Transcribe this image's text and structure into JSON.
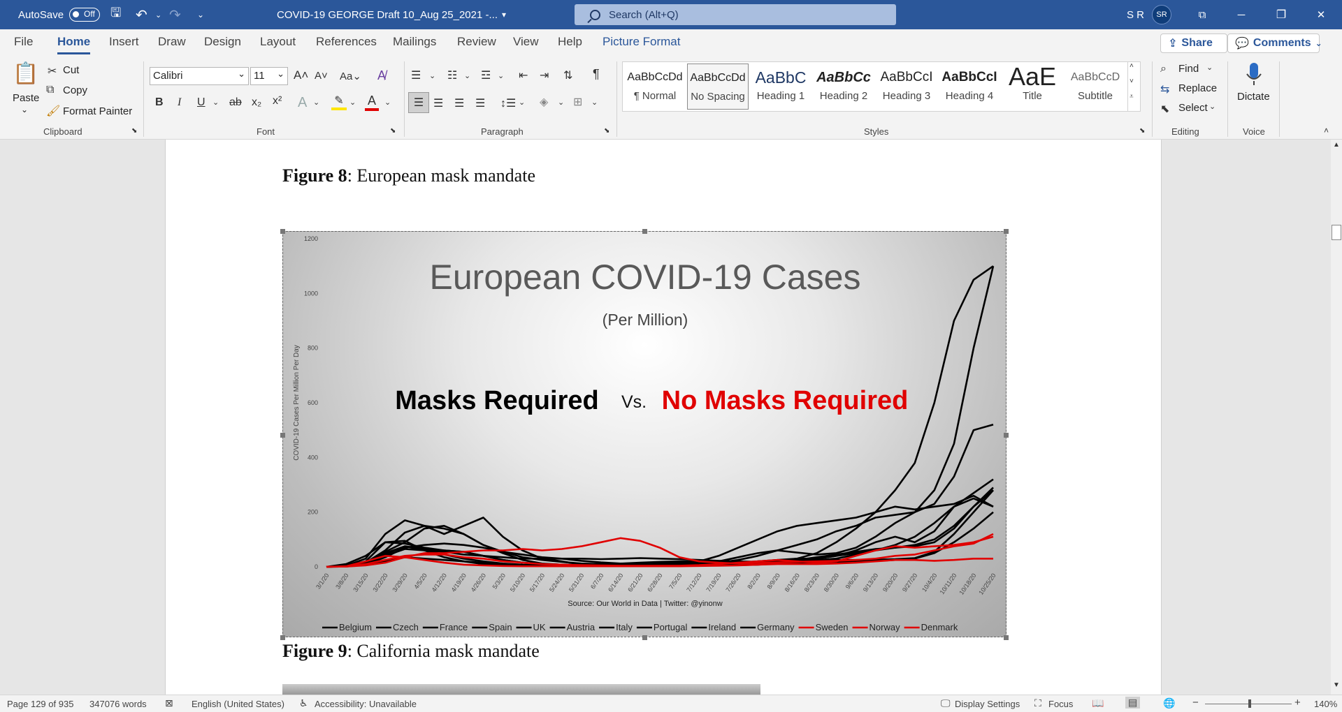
{
  "titlebar": {
    "autosave_label": "AutoSave",
    "autosave_state": "Off",
    "doc_title": "COVID-19 GEORGE Draft 10_Aug 25_2021  -...",
    "search_placeholder": "Search (Alt+Q)",
    "user_initials": "S R",
    "avatar_initials": "SR"
  },
  "tabs": [
    "File",
    "Home",
    "Insert",
    "Draw",
    "Design",
    "Layout",
    "References",
    "Mailings",
    "Review",
    "View",
    "Help",
    "Picture Format"
  ],
  "tabs_right": {
    "share": "Share",
    "comments": "Comments"
  },
  "clipboard": {
    "paste": "Paste",
    "cut": "Cut",
    "copy": "Copy",
    "format_painter": "Format Painter",
    "group": "Clipboard"
  },
  "font": {
    "name": "Calibri",
    "size": "11",
    "group": "Font"
  },
  "paragraph": {
    "group": "Paragraph"
  },
  "styles": {
    "group": "Styles",
    "items": [
      {
        "preview": "AaBbCcDd",
        "name": "¶ Normal"
      },
      {
        "preview": "AaBbCcDd",
        "name": "No Spacing"
      },
      {
        "preview": "AaBbC",
        "name": "Heading 1"
      },
      {
        "preview": "AaBbCc",
        "name": "Heading 2"
      },
      {
        "preview": "AaBbCcI",
        "name": "Heading 3"
      },
      {
        "preview": "AaBbCcI",
        "name": "Heading 4"
      },
      {
        "preview": "AaE",
        "name": "Title"
      },
      {
        "preview": "AaBbCcD",
        "name": "Subtitle"
      }
    ]
  },
  "editing": {
    "find": "Find",
    "replace": "Replace",
    "select": "Select",
    "group": "Editing"
  },
  "voice": {
    "dictate": "Dictate",
    "group": "Voice"
  },
  "document": {
    "caption8_bold": "Figure 8",
    "caption8_rest": ": European mask mandate",
    "caption9_bold": "Figure 9",
    "caption9_rest": ": California mask mandate"
  },
  "chart_data": {
    "type": "line",
    "title": "European COVID-19 Cases",
    "subtitle": "(Per Million)",
    "annotation_left": "Masks Required",
    "annotation_vs": "Vs.",
    "annotation_right": "No Masks Required",
    "ylabel": "COVID-19 Cases Per Million Per Day",
    "ylim": [
      0,
      1200
    ],
    "yticks": [
      "1200",
      "1000",
      "800",
      "600",
      "400",
      "200",
      "0"
    ],
    "source": "Source: Our World in Data | Twitter: @yinonw",
    "colors": {
      "masks": "#000000",
      "no_masks": "#e00000"
    },
    "categories": [
      "3/1/20",
      "3/8/20",
      "3/15/20",
      "3/22/20",
      "3/29/20",
      "4/5/20",
      "4/12/20",
      "4/19/20",
      "4/26/20",
      "5/3/20",
      "5/10/20",
      "5/17/20",
      "5/24/20",
      "5/31/20",
      "6/7/20",
      "6/14/20",
      "6/21/20",
      "6/28/20",
      "7/5/20",
      "7/12/20",
      "7/19/20",
      "7/26/20",
      "8/2/20",
      "8/9/20",
      "8/16/20",
      "8/23/20",
      "8/30/20",
      "9/6/20",
      "9/13/20",
      "9/20/20",
      "9/27/20",
      "10/4/20",
      "10/11/20",
      "10/18/20",
      "10/25/20"
    ],
    "series": [
      {
        "name": "Belgium",
        "group": "masks",
        "values": [
          0,
          3,
          15,
          60,
          125,
          150,
          140,
          120,
          80,
          55,
          35,
          25,
          18,
          12,
          10,
          10,
          9,
          9,
          10,
          14,
          20,
          35,
          50,
          60,
          52,
          45,
          50,
          70,
          110,
          160,
          200,
          280,
          450,
          800,
          1100
        ]
      },
      {
        "name": "Czech",
        "group": "masks",
        "values": [
          0,
          2,
          8,
          20,
          35,
          30,
          25,
          20,
          15,
          10,
          6,
          5,
          5,
          6,
          10,
          12,
          15,
          18,
          20,
          20,
          18,
          15,
          18,
          22,
          30,
          50,
          90,
          140,
          200,
          280,
          380,
          600,
          900,
          1050,
          1100
        ]
      },
      {
        "name": "France",
        "group": "masks",
        "values": [
          0,
          3,
          12,
          45,
          75,
          65,
          60,
          55,
          40,
          25,
          15,
          10,
          8,
          6,
          5,
          5,
          6,
          7,
          8,
          10,
          15,
          25,
          40,
          60,
          80,
          100,
          130,
          150,
          180,
          190,
          200,
          230,
          330,
          500,
          520
        ]
      },
      {
        "name": "Spain",
        "group": "masks",
        "values": [
          0,
          4,
          30,
          120,
          170,
          150,
          120,
          150,
          180,
          110,
          60,
          30,
          20,
          8,
          5,
          4,
          5,
          8,
          12,
          20,
          40,
          70,
          100,
          130,
          150,
          160,
          170,
          180,
          200,
          220,
          210,
          220,
          230,
          260,
          220
        ]
      },
      {
        "name": "UK",
        "group": "masks",
        "values": [
          0,
          2,
          8,
          35,
          70,
          80,
          85,
          80,
          70,
          55,
          45,
          35,
          30,
          22,
          16,
          12,
          10,
          10,
          9,
          9,
          10,
          12,
          15,
          18,
          20,
          25,
          30,
          45,
          60,
          80,
          110,
          160,
          220,
          270,
          320
        ]
      },
      {
        "name": "Austria",
        "group": "masks",
        "values": [
          0,
          3,
          20,
          90,
          95,
          60,
          35,
          20,
          10,
          6,
          5,
          5,
          5,
          4,
          5,
          6,
          8,
          12,
          15,
          15,
          15,
          15,
          20,
          22,
          25,
          30,
          40,
          50,
          60,
          70,
          80,
          100,
          150,
          220,
          290
        ]
      },
      {
        "name": "Italy",
        "group": "masks",
        "values": [
          0,
          10,
          40,
          90,
          85,
          70,
          60,
          55,
          40,
          25,
          15,
          10,
          8,
          5,
          4,
          3,
          4,
          4,
          4,
          4,
          5,
          6,
          8,
          12,
          18,
          22,
          25,
          25,
          26,
          28,
          32,
          55,
          120,
          200,
          280
        ]
      },
      {
        "name": "Portugal",
        "group": "masks",
        "values": [
          0,
          2,
          15,
          50,
          75,
          60,
          55,
          45,
          40,
          35,
          30,
          30,
          30,
          30,
          28,
          30,
          32,
          30,
          28,
          25,
          22,
          20,
          18,
          20,
          25,
          35,
          45,
          55,
          65,
          70,
          75,
          90,
          140,
          220,
          280
        ]
      },
      {
        "name": "Ireland",
        "group": "masks",
        "values": [
          0,
          2,
          15,
          55,
          90,
          140,
          150,
          120,
          80,
          50,
          25,
          12,
          8,
          6,
          4,
          3,
          3,
          3,
          3,
          4,
          6,
          10,
          20,
          25,
          30,
          30,
          40,
          60,
          90,
          110,
          90,
          130,
          220,
          250,
          220
        ]
      },
      {
        "name": "Germany",
        "group": "masks",
        "values": [
          0,
          1,
          8,
          40,
          65,
          60,
          45,
          30,
          20,
          12,
          8,
          7,
          6,
          5,
          4,
          5,
          5,
          5,
          5,
          5,
          6,
          8,
          10,
          12,
          15,
          16,
          18,
          20,
          22,
          25,
          30,
          50,
          90,
          140,
          200
        ]
      },
      {
        "name": "Sweden",
        "group": "no_masks",
        "values": [
          0,
          1,
          5,
          15,
          35,
          50,
          50,
          55,
          60,
          60,
          65,
          60,
          65,
          75,
          90,
          105,
          95,
          70,
          35,
          20,
          15,
          12,
          14,
          16,
          18,
          20,
          22,
          25,
          30,
          40,
          45,
          60,
          75,
          85,
          120
        ]
      },
      {
        "name": "Norway",
        "group": "no_masks",
        "values": [
          0,
          2,
          20,
          40,
          35,
          25,
          15,
          8,
          5,
          3,
          2,
          2,
          2,
          2,
          2,
          2,
          2,
          2,
          2,
          3,
          4,
          5,
          8,
          10,
          10,
          10,
          12,
          15,
          20,
          25,
          25,
          22,
          25,
          30,
          30
        ]
      },
      {
        "name": "Denmark",
        "group": "no_masks",
        "values": [
          0,
          1,
          10,
          25,
          40,
          45,
          45,
          35,
          30,
          20,
          15,
          10,
          8,
          6,
          5,
          4,
          4,
          4,
          4,
          6,
          10,
          15,
          20,
          25,
          20,
          15,
          20,
          40,
          60,
          75,
          70,
          75,
          80,
          90,
          110
        ]
      }
    ]
  },
  "status": {
    "page": "Page 129 of 935",
    "words": "347076 words",
    "language": "English (United States)",
    "accessibility": "Accessibility: Unavailable",
    "display_settings": "Display Settings",
    "focus": "Focus",
    "zoom": "140%"
  }
}
